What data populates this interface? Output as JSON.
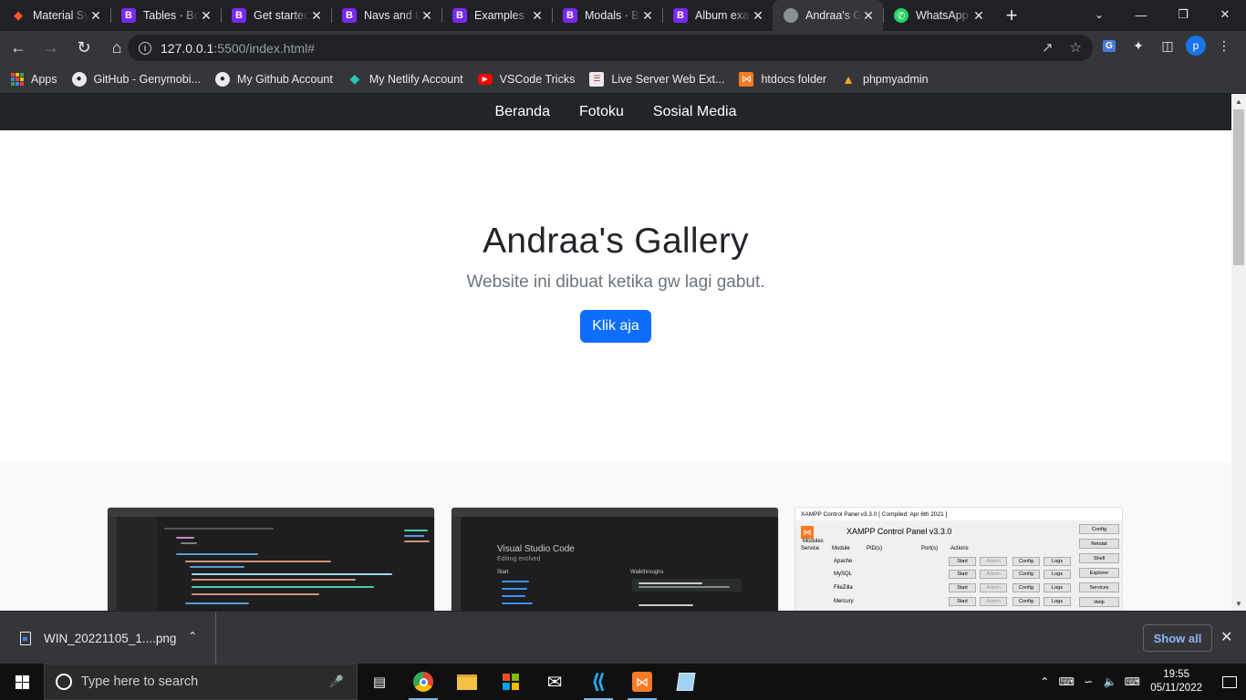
{
  "browser": {
    "tabs": [
      {
        "title": "Material Sy",
        "icon": "material-logo-icon"
      },
      {
        "title": "Tables · Bo",
        "icon": "bootstrap-icon"
      },
      {
        "title": "Get startec",
        "icon": "bootstrap-icon"
      },
      {
        "title": "Navs and t",
        "icon": "bootstrap-icon"
      },
      {
        "title": "Examples ·",
        "icon": "bootstrap-icon"
      },
      {
        "title": "Modals · B",
        "icon": "bootstrap-icon"
      },
      {
        "title": "Album exa",
        "icon": "bootstrap-icon"
      },
      {
        "title": "Andraa's G",
        "icon": "globe-icon",
        "active": true
      },
      {
        "title": "WhatsApp",
        "icon": "whatsapp-icon"
      }
    ],
    "url_host": "127.0.0.1",
    "url_path": ":5500/index.html#",
    "profile_initial": "p",
    "bookmarks": [
      {
        "label": "Apps",
        "icon": "apps-grid-icon"
      },
      {
        "label": "GitHub - Genymobi...",
        "icon": "github-icon"
      },
      {
        "label": "My Github Account",
        "icon": "github-icon"
      },
      {
        "label": "My Netlify Account",
        "icon": "netlify-icon"
      },
      {
        "label": "VSCode Tricks",
        "icon": "youtube-icon"
      },
      {
        "label": "Live Server Web Ext...",
        "icon": "live-server-icon"
      },
      {
        "label": "htdocs folder",
        "icon": "xampp-icon"
      },
      {
        "label": "phpmyadmin",
        "icon": "phpmyadmin-icon"
      }
    ]
  },
  "site": {
    "nav": [
      "Beranda",
      "Fotoku",
      "Sosial Media"
    ],
    "hero_title": "Andraa's Gallery",
    "hero_subtitle": "Website ini dibuat ketika gw lagi gabut.",
    "hero_button": "Klik aja",
    "cards": [
      {
        "thumbnail": "vscode-editor-screenshot"
      },
      {
        "thumbnail": "vscode-welcome-screenshot",
        "title": "Visual Studio Code",
        "subtitle": "Editing evolved",
        "start_label": "Start",
        "walkthroughs_label": "Walkthroughs"
      },
      {
        "thumbnail": "xampp-control-panel-screenshot",
        "window_title": "XAMPP Control Panel v3.3.0  [ Compiled: Apr 6th 2021 ]",
        "header": "XAMPP Control Panel v3.3.0",
        "modules_label": "Modules",
        "service_label": "Service",
        "module_label": "Module",
        "pid_label": "PID(s)",
        "ports_label": "Port(s)",
        "actions_label": "Actions",
        "modules": [
          "Apache",
          "MySQL",
          "FileZilla",
          "Mercury"
        ],
        "side_buttons": [
          "Config",
          "Netstat",
          "Shell",
          "Explorer",
          "Services",
          "Help"
        ],
        "row_buttons": [
          "Start",
          "Admin",
          "Config",
          "Logs"
        ]
      }
    ]
  },
  "downloads": {
    "file_name": "WIN_20221105_1....png",
    "show_all": "Show all"
  },
  "taskbar": {
    "search_placeholder": "Type here to search",
    "apps": [
      "chrome-icon",
      "file-explorer-icon",
      "store-icon",
      "mail-icon",
      "vscode-icon",
      "xampp-icon",
      "notepad-icon"
    ],
    "time": "19:55",
    "date": "05/11/2022"
  }
}
